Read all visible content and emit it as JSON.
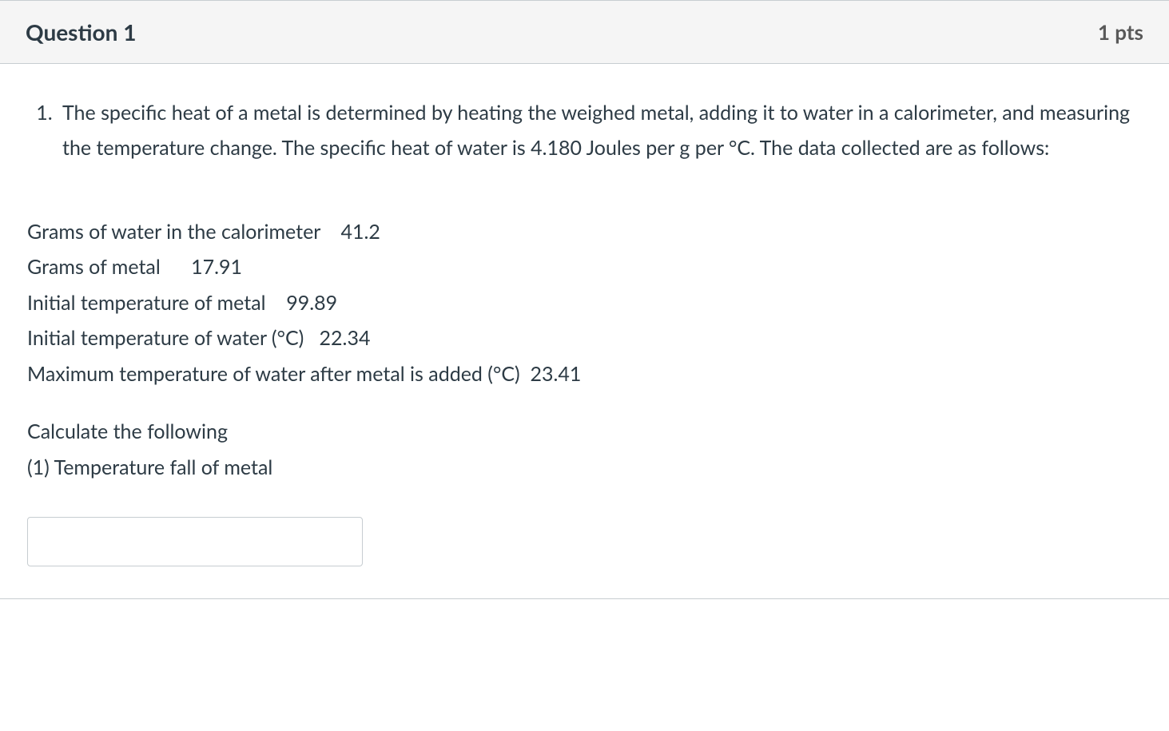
{
  "header": {
    "title": "Question 1",
    "points": "1 pts"
  },
  "prompt": {
    "number": "1.",
    "text": "The specific heat of a metal is determined by heating the weighed metal, adding it to water in a calorimeter, and measuring the temperature change.  The specific heat of water is 4.180 Joules per g per °C.  The data collected are as follows:"
  },
  "data_rows": [
    {
      "label": "Grams of water in the calorimeter",
      "value": "41.2",
      "spacer": "    "
    },
    {
      "label": "Grams of metal",
      "value": "17.91",
      "spacer": "      "
    },
    {
      "label": "Initial temperature of metal",
      "value": "99.89",
      "spacer": "    "
    },
    {
      "label": "Initial temperature of water (°C)",
      "value": "22.34",
      "spacer": "   "
    },
    {
      "label": "Maximum temperature of water after metal is added (°C)",
      "value": "23.41",
      "spacer": "  "
    }
  ],
  "calculate": {
    "heading": "Calculate the following",
    "item": "(1) Temperature fall of metal"
  },
  "input": {
    "value": "",
    "placeholder": ""
  }
}
